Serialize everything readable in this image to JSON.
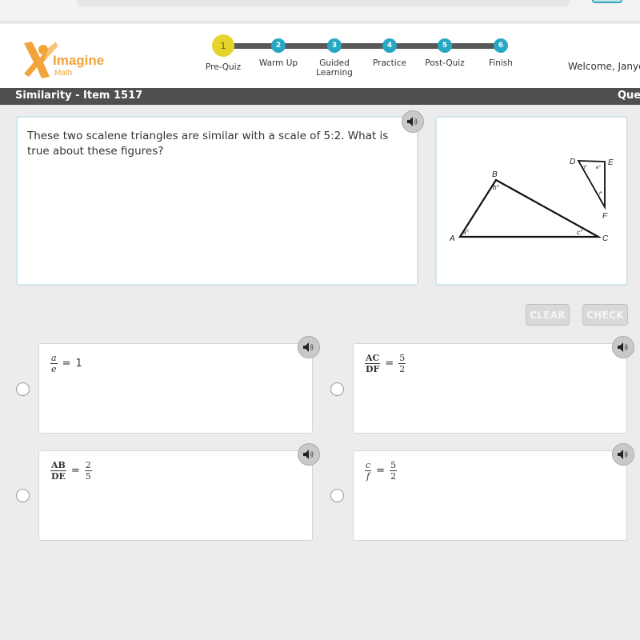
{
  "app": {
    "logo_text": "Imagine",
    "logo_subtext": "Math",
    "welcome": "Welcome, Janye"
  },
  "progress": {
    "current_step": 1,
    "steps": [
      {
        "number": "1",
        "label": "Pre-Quiz"
      },
      {
        "number": "2",
        "label": "Warm Up"
      },
      {
        "number": "3",
        "label": "Guided Learning"
      },
      {
        "number": "4",
        "label": "Practice"
      },
      {
        "number": "5",
        "label": "Post-Quiz"
      },
      {
        "number": "6",
        "label": "Finish"
      }
    ]
  },
  "titlebar": {
    "title": "Similarity - Item 1517",
    "right_label": "Que"
  },
  "question": {
    "text": "These two scalene triangles are similar with a scale of 5:2. What is true about these figures?",
    "audio_icon": "speaker-icon"
  },
  "figure": {
    "large_triangle": {
      "vertices": [
        "A",
        "B",
        "C"
      ],
      "angles": [
        "a°",
        "b°",
        "c°"
      ]
    },
    "small_triangle": {
      "vertices": [
        "D",
        "E",
        "F"
      ],
      "angles": [
        "d°",
        "e°",
        "f°"
      ]
    }
  },
  "actions": {
    "clear_label": "CLEAR",
    "check_label": "CHECK"
  },
  "choices": [
    {
      "num": "a",
      "den": "e",
      "style": "italic",
      "rhs": "1",
      "rhs_type": "number"
    },
    {
      "num": "AC",
      "den": "DF",
      "style": "bold",
      "rhs_num": "5",
      "rhs_den": "2",
      "rhs_type": "fraction"
    },
    {
      "num": "AB",
      "den": "DE",
      "style": "bold",
      "rhs_num": "2",
      "rhs_den": "5",
      "rhs_type": "fraction"
    },
    {
      "num": "c",
      "den": "f",
      "style": "italic",
      "rhs_num": "5",
      "rhs_den": "2",
      "rhs_type": "fraction"
    }
  ],
  "colors": {
    "brand_orange": "#f2a33a",
    "step_current": "#e5d42c",
    "step_other": "#27a7c2",
    "titlebar": "#4e4f50"
  }
}
